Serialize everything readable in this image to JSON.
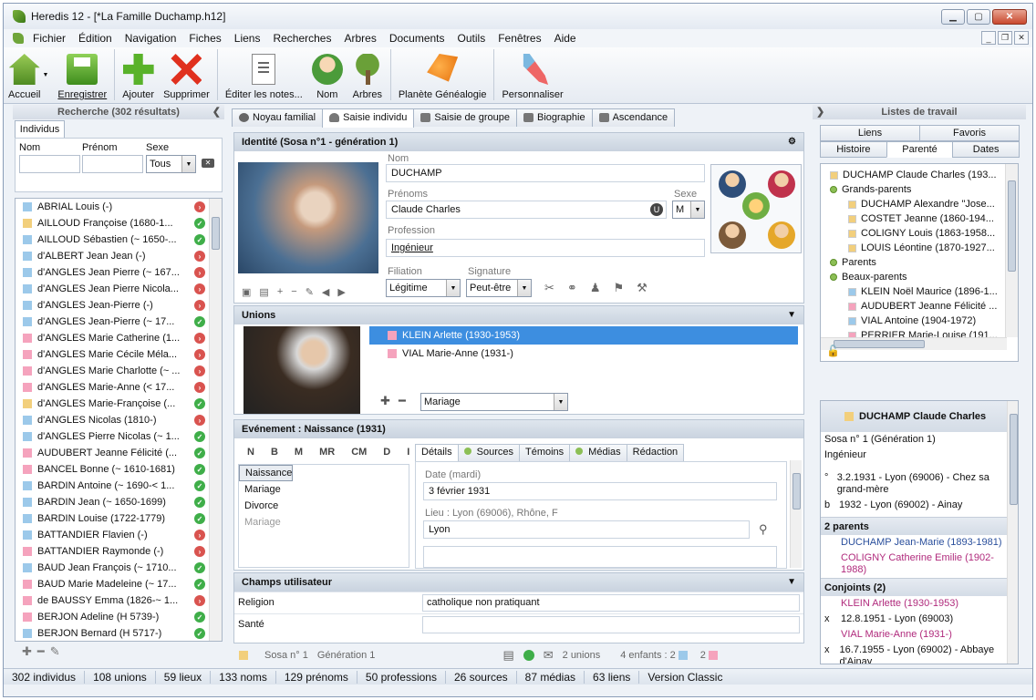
{
  "window": {
    "title": "Heredis 12 - [*La Famille Duchamp.h12]"
  },
  "menu": [
    "Fichier",
    "Édition",
    "Navigation",
    "Fiches",
    "Liens",
    "Recherches",
    "Arbres",
    "Documents",
    "Outils",
    "Fenêtres",
    "Aide"
  ],
  "toolbar": [
    {
      "label": "Accueil",
      "icon": "home-icon"
    },
    {
      "label": "Enregistrer",
      "icon": "save-icon"
    },
    {
      "label": "Ajouter",
      "icon": "add-icon"
    },
    {
      "label": "Supprimer",
      "icon": "delete-icon"
    },
    {
      "label": "Éditer les notes...",
      "icon": "notes-icon"
    },
    {
      "label": "Nom",
      "icon": "name-icon"
    },
    {
      "label": "Arbres",
      "icon": "tree-icon"
    },
    {
      "label": "Planète Généalogie",
      "icon": "planet-icon"
    },
    {
      "label": "Personnaliser",
      "icon": "customize-icon"
    }
  ],
  "search": {
    "title": "Recherche (302 résultats)",
    "tab": "Individus",
    "nom_label": "Nom",
    "prenom_label": "Prénom",
    "sexe_label": "Sexe",
    "sexe_value": "Tous",
    "results": [
      {
        "name": "ABRIAL Louis (-)",
        "sex": "m",
        "status": "red"
      },
      {
        "name": "AILLOUD Françoise (1680-1...",
        "sex": "u",
        "status": "green"
      },
      {
        "name": "AILLOUD Sébastien (~ 1650-...",
        "sex": "m",
        "status": "green"
      },
      {
        "name": "d'ALBERT Jean Jean (-)",
        "sex": "m",
        "status": "red"
      },
      {
        "name": "d'ANGLES Jean Pierre (~ 167...",
        "sex": "m",
        "status": "red"
      },
      {
        "name": "d'ANGLES Jean Pierre Nicola...",
        "sex": "m",
        "status": "red"
      },
      {
        "name": "d'ANGLES Jean-Pierre (-)",
        "sex": "m",
        "status": "red"
      },
      {
        "name": "d'ANGLES Jean-Pierre (~ 17...",
        "sex": "m",
        "status": "green"
      },
      {
        "name": "d'ANGLES Marie Catherine (1...",
        "sex": "f",
        "status": "red"
      },
      {
        "name": "d'ANGLES Marie Cécile Méla...",
        "sex": "f",
        "status": "red"
      },
      {
        "name": "d'ANGLES Marie Charlotte (~ ...",
        "sex": "f",
        "status": "red"
      },
      {
        "name": "d'ANGLES Marie-Anne (< 17...",
        "sex": "f",
        "status": "red"
      },
      {
        "name": "d'ANGLES Marie-Françoise (...",
        "sex": "u",
        "status": "green"
      },
      {
        "name": "d'ANGLES Nicolas (1810-)",
        "sex": "m",
        "status": "red"
      },
      {
        "name": "d'ANGLES Pierre Nicolas (~ 1...",
        "sex": "m",
        "status": "green"
      },
      {
        "name": "AUDUBERT Jeanne Félicité (...",
        "sex": "f",
        "status": "green"
      },
      {
        "name": "BANCEL Bonne (~ 1610-1681)",
        "sex": "f",
        "status": "green"
      },
      {
        "name": "BARDIN Antoine (~ 1690-< 1...",
        "sex": "m",
        "status": "green"
      },
      {
        "name": "BARDIN Jean (~ 1650-1699)",
        "sex": "m",
        "status": "green"
      },
      {
        "name": "BARDIN Louise (1722-1779)",
        "sex": "m",
        "status": "green"
      },
      {
        "name": "BATTANDIER Flavien (-)",
        "sex": "m",
        "status": "red"
      },
      {
        "name": "BATTANDIER Raymonde (-)",
        "sex": "f",
        "status": "red"
      },
      {
        "name": "BAUD Jean François (~ 1710...",
        "sex": "m",
        "status": "green"
      },
      {
        "name": "BAUD Marie Madeleine (~ 17...",
        "sex": "f",
        "status": "green"
      },
      {
        "name": "de BAUSSY Emma (1826-~ 1...",
        "sex": "f",
        "status": "red"
      },
      {
        "name": "BERJON Adeline (H 5739-)",
        "sex": "f",
        "status": "green"
      },
      {
        "name": "BERJON Bernard (H 5717-)",
        "sex": "m",
        "status": "green"
      }
    ]
  },
  "center": {
    "tabs": [
      "Noyau familial",
      "Saisie individu",
      "Saisie de groupe",
      "Biographie",
      "Ascendance"
    ],
    "identity_title": "Identité (Sosa n°1 - génération 1)",
    "nom_label": "Nom",
    "nom": "DUCHAMP",
    "prenoms_label": "Prénoms",
    "prenoms": "Claude Charles",
    "sexe_label": "Sexe",
    "sexe": "M",
    "profession_label": "Profession",
    "profession": "Ingénieur",
    "filiation_label": "Filiation",
    "filiation": "Légitime",
    "signature_label": "Signature",
    "signature": "Peut-être",
    "unions_title": "Unions",
    "unions": [
      "KLEIN Arlette (1930-1953)",
      "VIAL Marie-Anne (1931-)"
    ],
    "union_type": "Mariage",
    "event_title": "Evénement : Naissance (1931)",
    "event_filters": [
      "N",
      "B",
      "M",
      "MR",
      "CM",
      "D",
      "I"
    ],
    "events": [
      "Naissance",
      "Baptême",
      "Mariage",
      "Divorce",
      "Mariage"
    ],
    "event_tabs": [
      "Détails",
      "Sources",
      "Témoins",
      "Médias",
      "Rédaction"
    ],
    "date_label": "Date (mardi)",
    "date": "3 février 1931",
    "lieu_label": "Lieu : Lyon (69006), Rhône, F",
    "lieu": "Lyon",
    "champs_title": "Champs utilisateur",
    "champs": [
      {
        "k": "Religion",
        "v": "catholique non pratiquant"
      },
      {
        "k": "Santé",
        "v": ""
      }
    ],
    "footer": {
      "sosa": "Sosa n° 1",
      "generation": "Génération 1",
      "unions": "2 unions",
      "enfants": "4 enfants : 2",
      "girls": "2"
    }
  },
  "right": {
    "title": "Listes de travail",
    "tabs_top": [
      "Liens",
      "Favoris"
    ],
    "tabs_bottom": [
      "Histoire",
      "Parenté",
      "Dates"
    ],
    "tree": [
      {
        "t": "DUCHAMP Claude Charles (193...",
        "kind": "sq",
        "sex": "u",
        "indent": 1
      },
      {
        "t": "Grands-parents",
        "kind": "dot",
        "indent": 1
      },
      {
        "t": "DUCHAMP Alexandre \"Jose...",
        "kind": "sq",
        "sex": "u",
        "indent": 2
      },
      {
        "t": "COSTET Jeanne (1860-194...",
        "kind": "sq",
        "sex": "u",
        "indent": 2
      },
      {
        "t": "COLIGNY Louis (1863-1958...",
        "kind": "sq",
        "sex": "u",
        "indent": 2
      },
      {
        "t": "LOUIS Léontine (1870-1927...",
        "kind": "sq",
        "sex": "u",
        "indent": 2
      },
      {
        "t": "Parents",
        "kind": "dot",
        "indent": 1
      },
      {
        "t": "Beaux-parents",
        "kind": "dot",
        "indent": 1
      },
      {
        "t": "KLEIN Noël Maurice (1896-1...",
        "kind": "sq",
        "sex": "m",
        "indent": 2
      },
      {
        "t": "AUDUBERT Jeanne Félicité ...",
        "kind": "sq",
        "sex": "f",
        "indent": 2
      },
      {
        "t": "VIAL Antoine (1904-1972)",
        "kind": "sq",
        "sex": "m",
        "indent": 2
      },
      {
        "t": "PERRIER Marie-Louise (191...",
        "kind": "sq",
        "sex": "f",
        "indent": 2
      }
    ],
    "detail": {
      "name": "DUCHAMP Claude Charles",
      "sosa": "Sosa n° 1 (Génération 1)",
      "job": "Ingénieur",
      "birth": "3.2.1931 - Lyon (69006) - Chez sa grand-mère",
      "bapt": "1932 - Lyon (69002) - Ainay",
      "parents_title": "2 parents",
      "father": "DUCHAMP Jean-Marie (1893-1981)",
      "mother": "COLIGNY Catherine Emilie (1902-1988)",
      "conj_title": "Conjoints (2)",
      "conj1": "KLEIN Arlette (1930-1953)",
      "conj1_date": "12.8.1951 - Lyon (69003)",
      "conj2": "VIAL Marie-Anne (1931-)",
      "conj2_date": "16.7.1955 - Lyon (69002) - Abbaye d'Ainay"
    }
  },
  "status": [
    "302 individus",
    "108 unions",
    "59 lieux",
    "133 noms",
    "129 prénoms",
    "50 professions",
    "26 sources",
    "87 médias",
    "63 liens",
    "Version Classic"
  ]
}
